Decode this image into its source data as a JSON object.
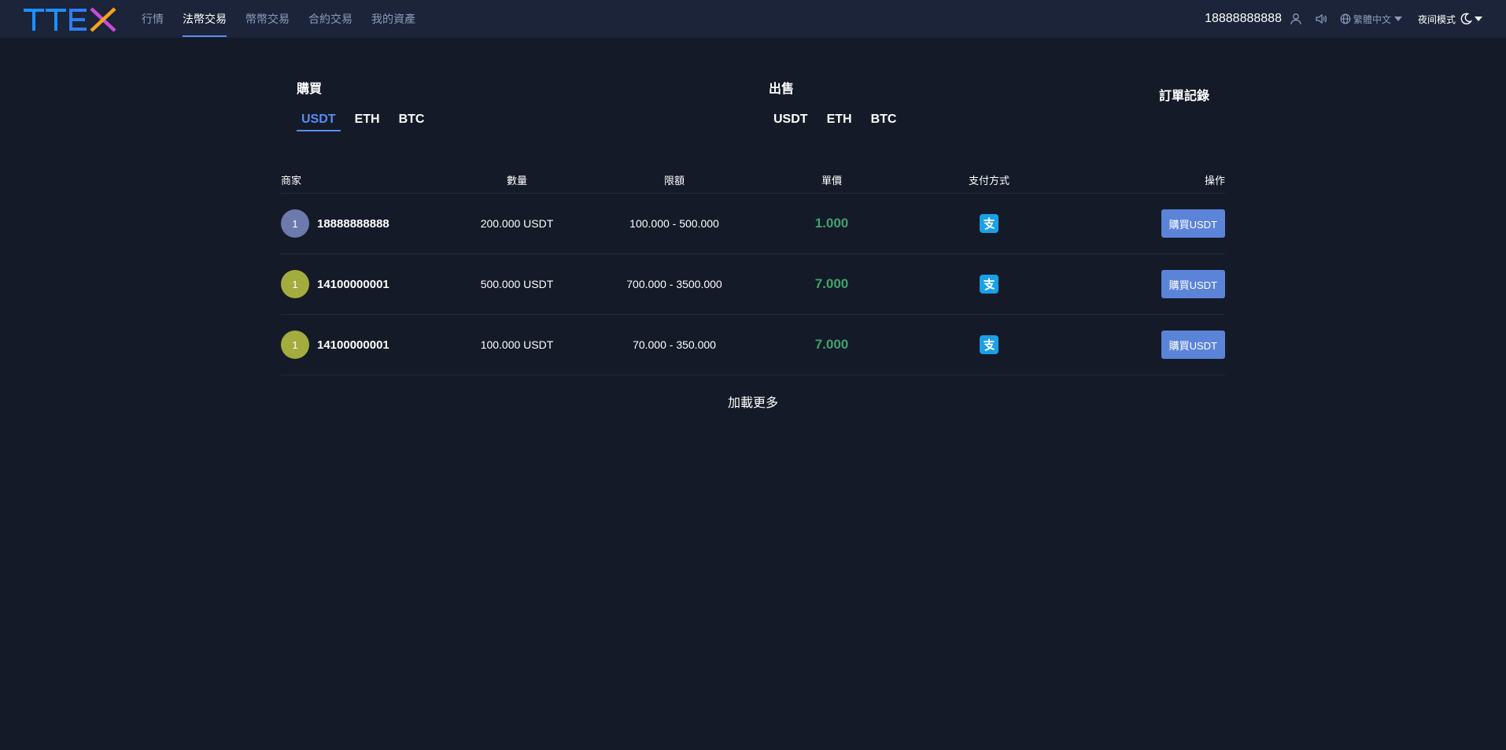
{
  "header": {
    "logo_text": "TTEX",
    "nav": [
      "行情",
      "法幣交易",
      "幣幣交易",
      "合約交易",
      "我的資產"
    ],
    "phone": "18888888888",
    "language": "繁體中文",
    "night_mode": "夜间模式"
  },
  "buy": {
    "title": "購買",
    "coins": [
      "USDT",
      "ETH",
      "BTC"
    ],
    "active": "USDT"
  },
  "sell": {
    "title": "出售",
    "coins": [
      "USDT",
      "ETH",
      "BTC"
    ]
  },
  "orders_link": "訂單記錄",
  "table": {
    "headers": [
      "商家",
      "數量",
      "限額",
      "單價",
      "支付方式",
      "操作"
    ],
    "rows": [
      {
        "avatar": "1",
        "avatar_color": "#6e79ad",
        "merchant": "18888888888",
        "amount": "200.000 USDT",
        "limit": "100.000 - 500.000",
        "price": "1.000",
        "payment_icon": "alipay-icon",
        "action": "購買USDT"
      },
      {
        "avatar": "1",
        "avatar_color": "#a3ac3e",
        "merchant": "14100000001",
        "amount": "500.000 USDT",
        "limit": "700.000 - 3500.000",
        "price": "7.000",
        "payment_icon": "alipay-icon",
        "action": "購買USDT"
      },
      {
        "avatar": "1",
        "avatar_color": "#a3ac3e",
        "merchant": "14100000001",
        "amount": "100.000 USDT",
        "limit": "70.000 - 350.000",
        "price": "7.000",
        "payment_icon": "alipay-icon",
        "action": "購買USDT"
      }
    ]
  },
  "load_more": "加載更多",
  "colors": {
    "background": "#141a28",
    "header": "#1b2438",
    "accent": "#5b8def",
    "price": "#3fa36b",
    "button": "#5b84d8"
  }
}
